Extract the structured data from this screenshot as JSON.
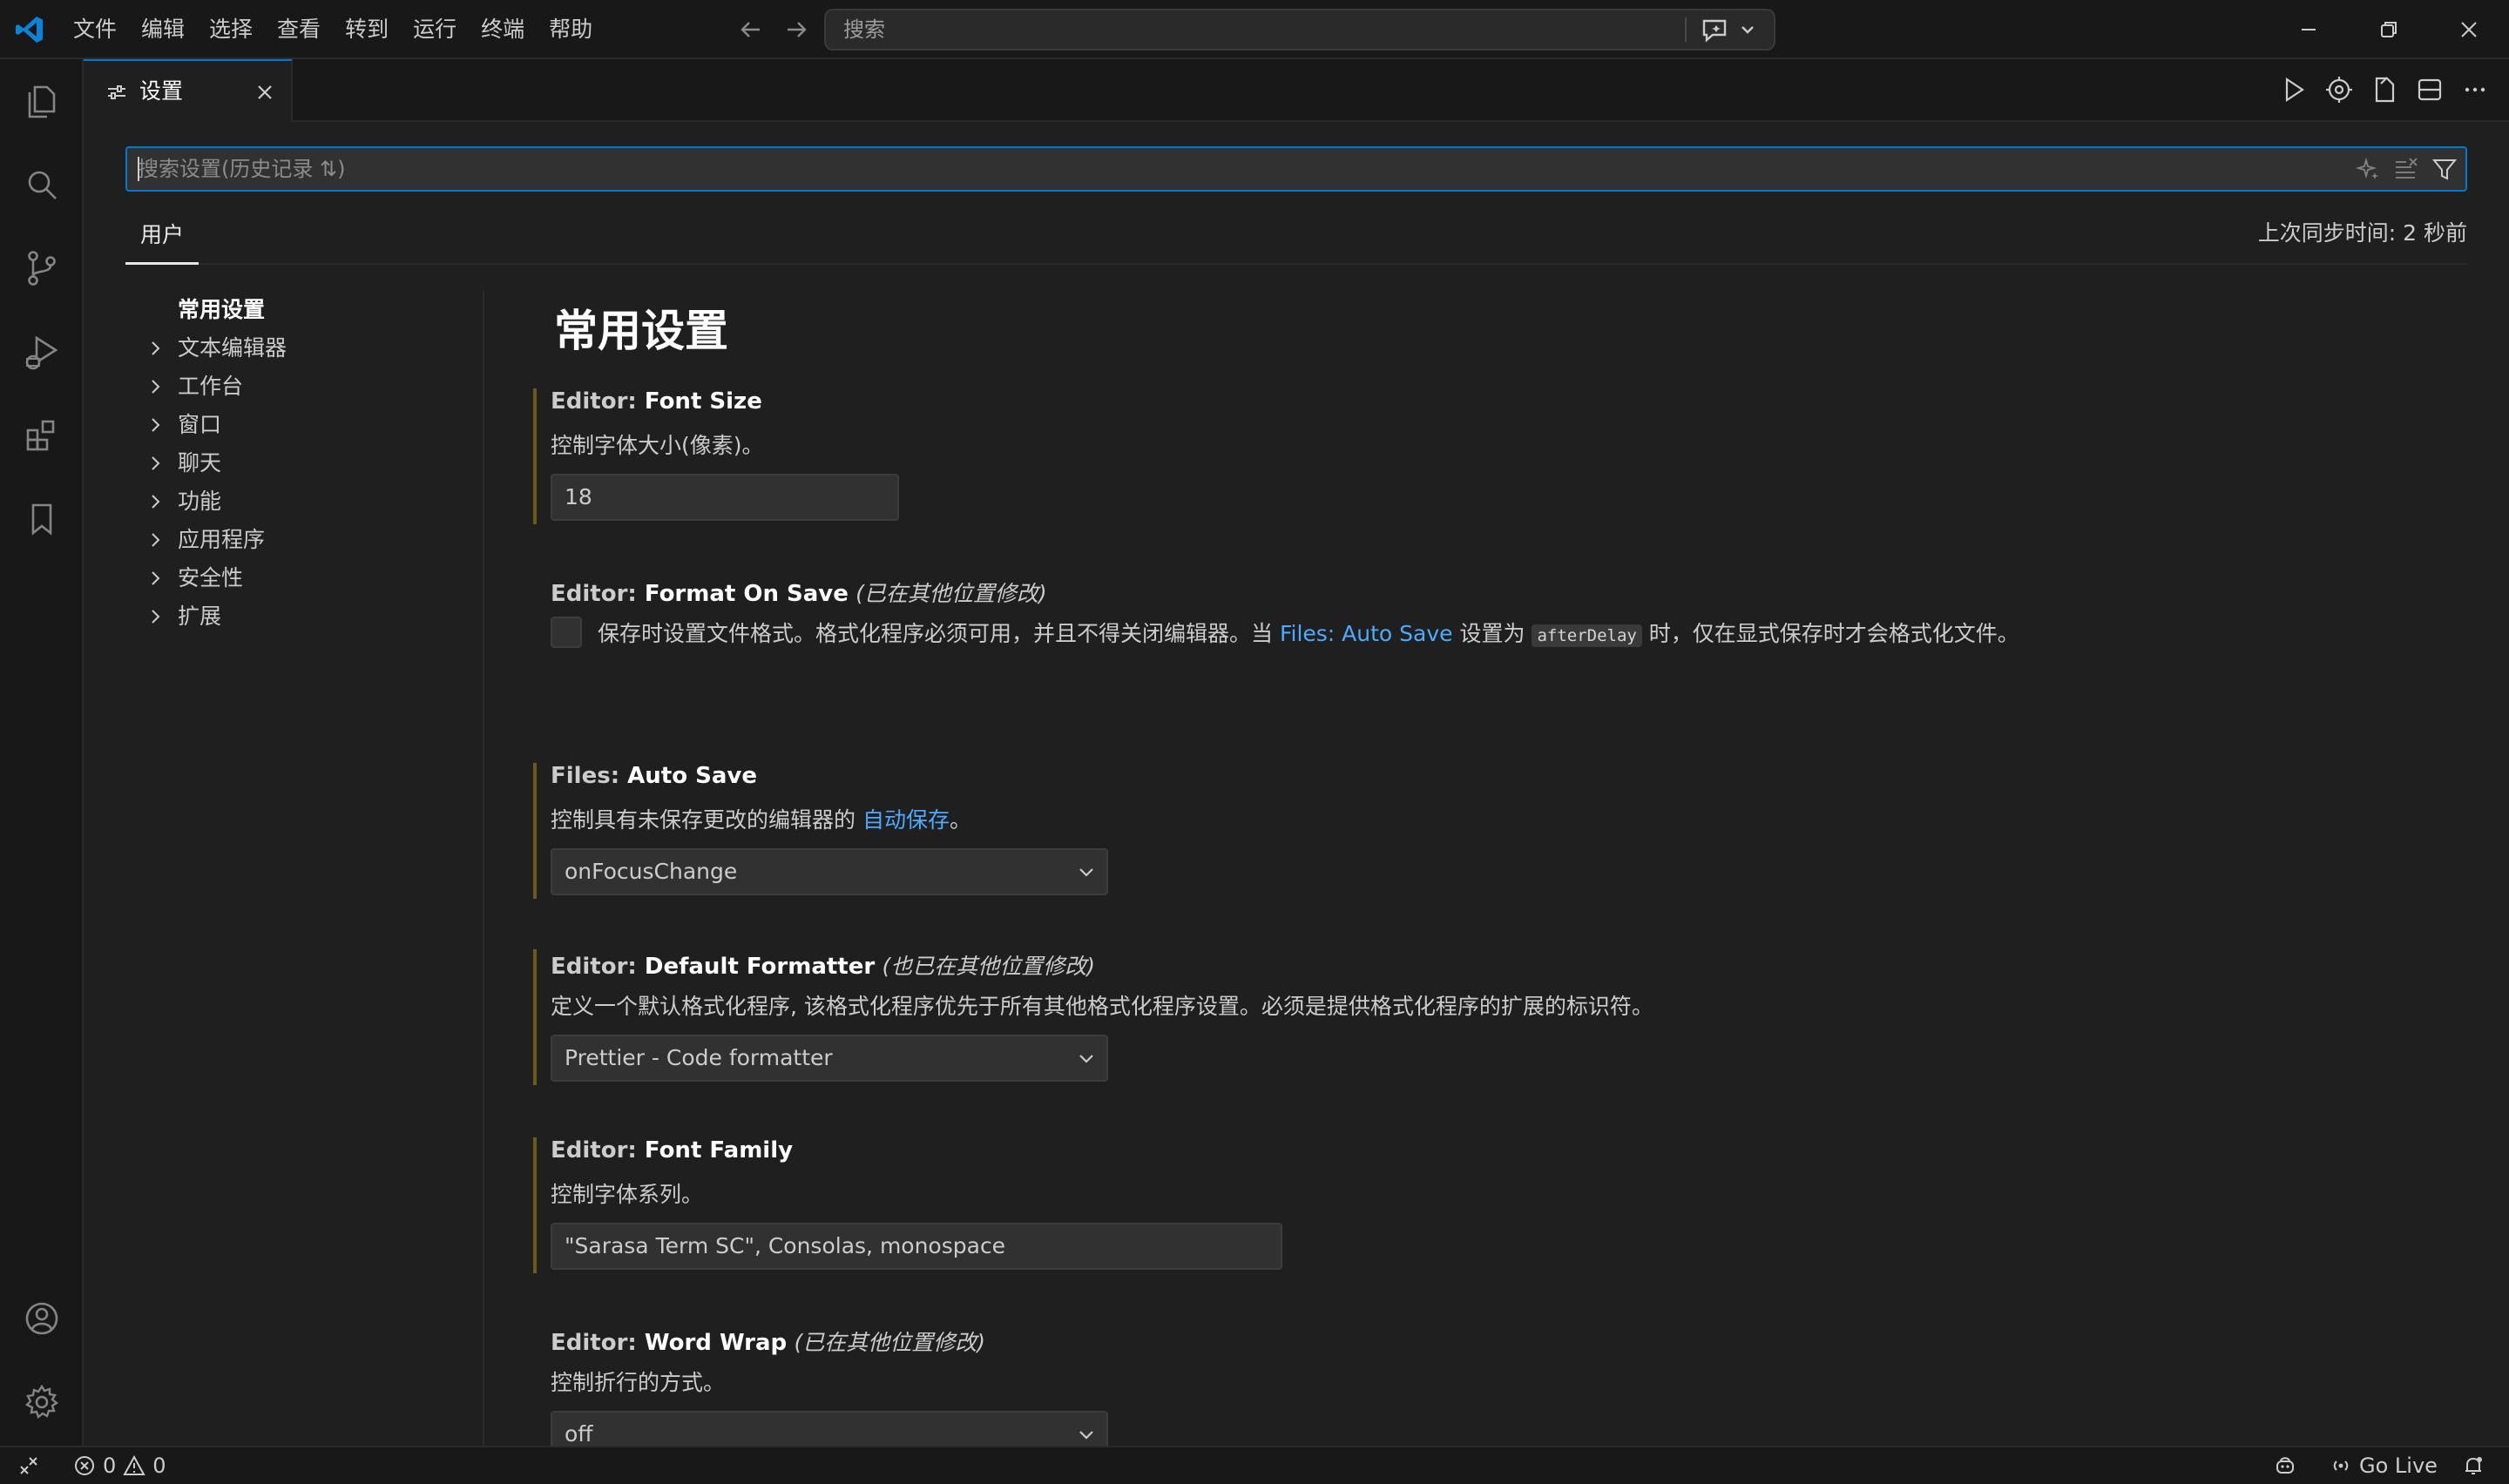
{
  "titlebar": {
    "menu": [
      "文件",
      "编辑",
      "选择",
      "查看",
      "转到",
      "运行",
      "终端",
      "帮助"
    ],
    "search_placeholder": "搜索"
  },
  "activitybar": {
    "icons": [
      "explorer-icon",
      "search-icon",
      "source-control-icon",
      "run-debug-icon",
      "extensions-icon",
      "bookmarks-icon",
      "accounts-icon",
      "manage-gear-icon"
    ]
  },
  "tab": {
    "label": "设置"
  },
  "settings": {
    "search_placeholder": "搜索设置(历史记录 ⇅)",
    "scope_tab": "用户",
    "sync_status": "上次同步时间: 2 秒前",
    "toc": [
      {
        "label": "常用设置",
        "expandable": false,
        "active": true
      },
      {
        "label": "文本编辑器",
        "expandable": true
      },
      {
        "label": "工作台",
        "expandable": true
      },
      {
        "label": "窗口",
        "expandable": true
      },
      {
        "label": "聊天",
        "expandable": true
      },
      {
        "label": "功能",
        "expandable": true
      },
      {
        "label": "应用程序",
        "expandable": true
      },
      {
        "label": "安全性",
        "expandable": true
      },
      {
        "label": "扩展",
        "expandable": true
      }
    ],
    "group_title": "常用设置",
    "font_size": {
      "category": "Editor: ",
      "name": "Font Size",
      "description": "控制字体大小(像素)。",
      "value": "18"
    },
    "format_on_save": {
      "category": "Editor: ",
      "name": "Format On Save",
      "modified": "(已在其他位置修改)",
      "desc_part1": "保存时设置文件格式。格式化程序必须可用，并且不得关闭编辑器。当 ",
      "desc_link": "Files: Auto Save",
      "desc_part2": " 设置为 ",
      "desc_code": "afterDelay",
      "desc_part3": " 时，仅在显式保存时才会格式化文件。",
      "checked": false
    },
    "auto_save": {
      "category": "Files: ",
      "name": "Auto Save",
      "desc_part1": "控制具有未保存更改的编辑器的 ",
      "desc_link": "自动保存",
      "desc_part2": "。",
      "value": "onFocusChange"
    },
    "default_formatter": {
      "category": "Editor: ",
      "name": "Default Formatter",
      "modified": "(也已在其他位置修改)",
      "description": "定义一个默认格式化程序, 该格式化程序优先于所有其他格式化程序设置。必须是提供格式化程序的扩展的标识符。",
      "value": "Prettier - Code formatter"
    },
    "font_family": {
      "category": "Editor: ",
      "name": "Font Family",
      "description": "控制字体系列。",
      "value": "\"Sarasa Term SC\", Consolas, monospace"
    },
    "word_wrap": {
      "category": "Editor: ",
      "name": "Word Wrap",
      "modified": "(已在其他位置修改)",
      "description": "控制折行的方式。",
      "value": "off"
    }
  },
  "statusbar": {
    "errors": "0",
    "warnings": "0",
    "go_live": "Go Live"
  },
  "colors": {
    "accent": "#0078d4",
    "link": "#4daafc",
    "modified_bar": "#6b5a1a",
    "background": "#1f1f1f",
    "chrome": "#181818"
  }
}
